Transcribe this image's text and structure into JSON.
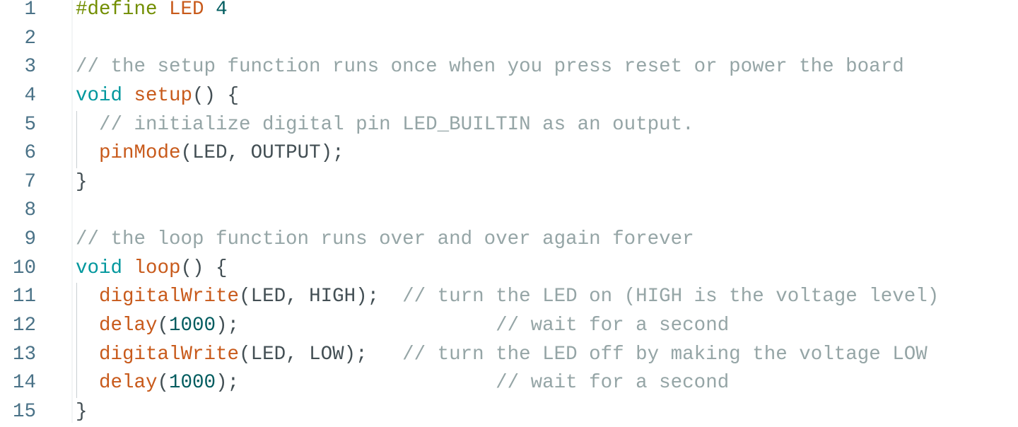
{
  "editor": {
    "colors": {
      "keyword": "#00979d",
      "preprocessor": "#728e00",
      "function": "#c85a1b",
      "comment": "#95a5a6",
      "number": "#005c5f",
      "text": "#434f54",
      "line_number": "#4a7287"
    },
    "lines": [
      {
        "n": "1",
        "guide": false,
        "tokens": [
          [
            "#define",
            "pp"
          ],
          [
            " ",
            "tx"
          ],
          [
            "LED",
            "mac"
          ],
          [
            " ",
            "tx"
          ],
          [
            "4",
            "num"
          ]
        ]
      },
      {
        "n": "2",
        "guide": false,
        "tokens": []
      },
      {
        "n": "3",
        "guide": false,
        "tokens": [
          [
            "// the setup function runs once when you press reset or power the board",
            "cm"
          ]
        ]
      },
      {
        "n": "4",
        "guide": false,
        "tokens": [
          [
            "void",
            "kw"
          ],
          [
            " ",
            "tx"
          ],
          [
            "setup",
            "fn"
          ],
          [
            "() {",
            "tx"
          ]
        ]
      },
      {
        "n": "5",
        "guide": true,
        "tokens": [
          [
            "  ",
            "tx"
          ],
          [
            "// initialize digital pin LED_BUILTIN as an output.",
            "cm"
          ]
        ]
      },
      {
        "n": "6",
        "guide": true,
        "tokens": [
          [
            "  ",
            "tx"
          ],
          [
            "pinMode",
            "fn"
          ],
          [
            "(LED, OUTPUT);",
            "tx"
          ]
        ]
      },
      {
        "n": "7",
        "guide": false,
        "tokens": [
          [
            "}",
            "tx"
          ]
        ]
      },
      {
        "n": "8",
        "guide": false,
        "tokens": []
      },
      {
        "n": "9",
        "guide": false,
        "tokens": [
          [
            "// the loop function runs over and over again forever",
            "cm"
          ]
        ]
      },
      {
        "n": "10",
        "guide": false,
        "tokens": [
          [
            "void",
            "kw"
          ],
          [
            " ",
            "tx"
          ],
          [
            "loop",
            "fn"
          ],
          [
            "() {",
            "tx"
          ]
        ]
      },
      {
        "n": "11",
        "guide": true,
        "tokens": [
          [
            "  ",
            "tx"
          ],
          [
            "digitalWrite",
            "fn"
          ],
          [
            "(LED, HIGH);  ",
            "tx"
          ],
          [
            "// turn the LED on (HIGH is the voltage level)",
            "cm"
          ]
        ]
      },
      {
        "n": "12",
        "guide": true,
        "tokens": [
          [
            "  ",
            "tx"
          ],
          [
            "delay",
            "fn"
          ],
          [
            "(",
            "tx"
          ],
          [
            "1000",
            "num"
          ],
          [
            ");                      ",
            "tx"
          ],
          [
            "// wait for a second",
            "cm"
          ]
        ]
      },
      {
        "n": "13",
        "guide": true,
        "tokens": [
          [
            "  ",
            "tx"
          ],
          [
            "digitalWrite",
            "fn"
          ],
          [
            "(LED, LOW);   ",
            "tx"
          ],
          [
            "// turn the LED off by making the voltage LOW",
            "cm"
          ]
        ]
      },
      {
        "n": "14",
        "guide": true,
        "tokens": [
          [
            "  ",
            "tx"
          ],
          [
            "delay",
            "fn"
          ],
          [
            "(",
            "tx"
          ],
          [
            "1000",
            "num"
          ],
          [
            ");                      ",
            "tx"
          ],
          [
            "// wait for a second",
            "cm"
          ]
        ]
      },
      {
        "n": "15",
        "guide": false,
        "tokens": [
          [
            "}",
            "tx"
          ]
        ]
      }
    ]
  }
}
